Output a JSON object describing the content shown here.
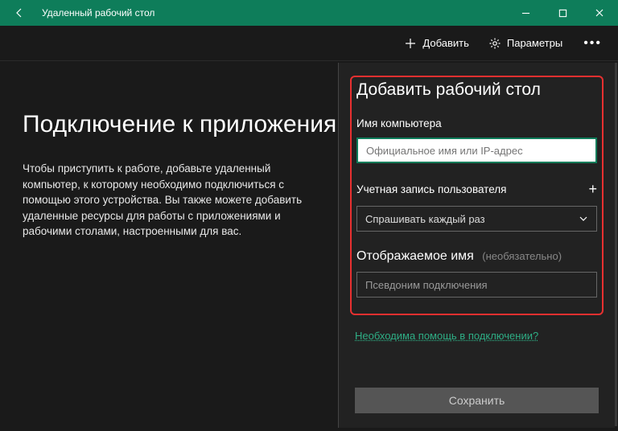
{
  "titlebar": {
    "title": "Удаленный рабочий стол"
  },
  "toolbar": {
    "add_label": "Добавить",
    "settings_label": "Параметры"
  },
  "main": {
    "heading": "Подключение к приложениям",
    "body": "Чтобы приступить к работе, добавьте удаленный компьютер, к которому необходимо подключиться с помощью этого устройства. Вы также можете добавить удаленные ресурсы для работы с приложениями и рабочими столами, настроенными для вас."
  },
  "panel": {
    "title": "Добавить рабочий стол",
    "computer_label": "Имя компьютера",
    "computer_placeholder": "Официальное имя или IP-адрес",
    "account_label": "Учетная запись пользователя",
    "account_value": "Спрашивать каждый раз",
    "display_label": "Отображаемое имя",
    "display_optional": "(необязательно)",
    "display_placeholder": "Псевдоним подключения",
    "help_link": "Необходима помощь в подключении?",
    "save_label": "Сохранить"
  }
}
